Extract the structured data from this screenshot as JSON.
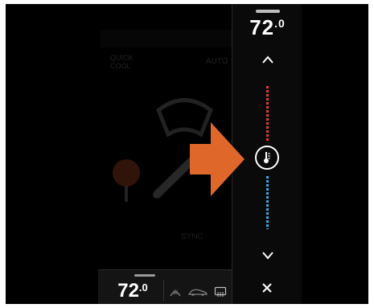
{
  "background_screen": {
    "title": "",
    "quick_cool_label": "QUICK COOL",
    "auto_label": "AUTO",
    "sync_label": "SYNC"
  },
  "temperature_panel": {
    "value": "72",
    "decimal": ".0",
    "up_icon": "chevron-up-icon",
    "down_icon": "chevron-down-icon",
    "slider_icon": "thermometer-icon",
    "close_icon": "close-icon",
    "colors": {
      "hot": "#e03a3a",
      "cold": "#3aa8e0"
    }
  },
  "bottom_bar": {
    "value": "72",
    "decimal": ".0",
    "icons": [
      "front-defrost-icon",
      "car-airflow-icon",
      "rear-defrost-icon"
    ]
  },
  "overlay": {
    "arrow_color": "#e0672a",
    "arrow_icon": "pointer-arrow-icon"
  }
}
